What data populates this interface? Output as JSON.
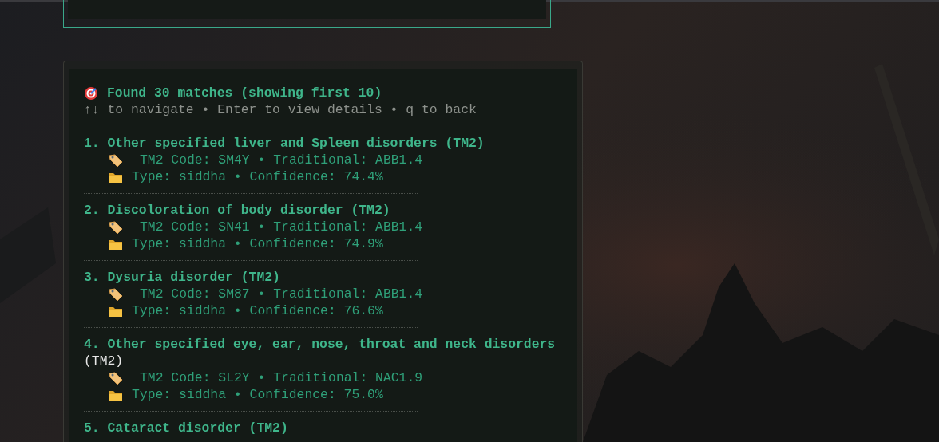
{
  "results": {
    "summary": "Found 30 matches (showing first 10)",
    "hint": "↑↓ to navigate • Enter to view details • q to back",
    "items": [
      {
        "number": "1.",
        "title": "Other specified liver and Spleen disorders",
        "suffix": "(TM2)",
        "kind": "inline",
        "code_line": "TM2 Code: SM4Y • Traditional: ABB1.4",
        "type_line": "Type: siddha • Confidence: 74.4%"
      },
      {
        "number": "2.",
        "title": "Discoloration of body disorder",
        "suffix": "(TM2)",
        "kind": "inline",
        "code_line": "TM2 Code: SN41 • Traditional: ABB1.4",
        "type_line": "Type: siddha • Confidence: 74.9%"
      },
      {
        "number": "3.",
        "title": "Dysuria disorder",
        "suffix": "(TM2)",
        "kind": "inline",
        "code_line": "TM2 Code: SM87 • Traditional: ABB1.4",
        "type_line": "Type: siddha • Confidence: 76.6%"
      },
      {
        "number": "4.",
        "title": "Other specified eye, ear, nose, throat and neck disorders",
        "suffix": "(TM2)",
        "kind": "wrapped",
        "code_line": "TM2 Code: SL2Y • Traditional: NAC1.9",
        "type_line": "Type: siddha • Confidence: 75.0%"
      },
      {
        "number": "5.",
        "title": "Cataract disorder",
        "suffix": "(TM2)",
        "kind": "inline"
      }
    ]
  }
}
